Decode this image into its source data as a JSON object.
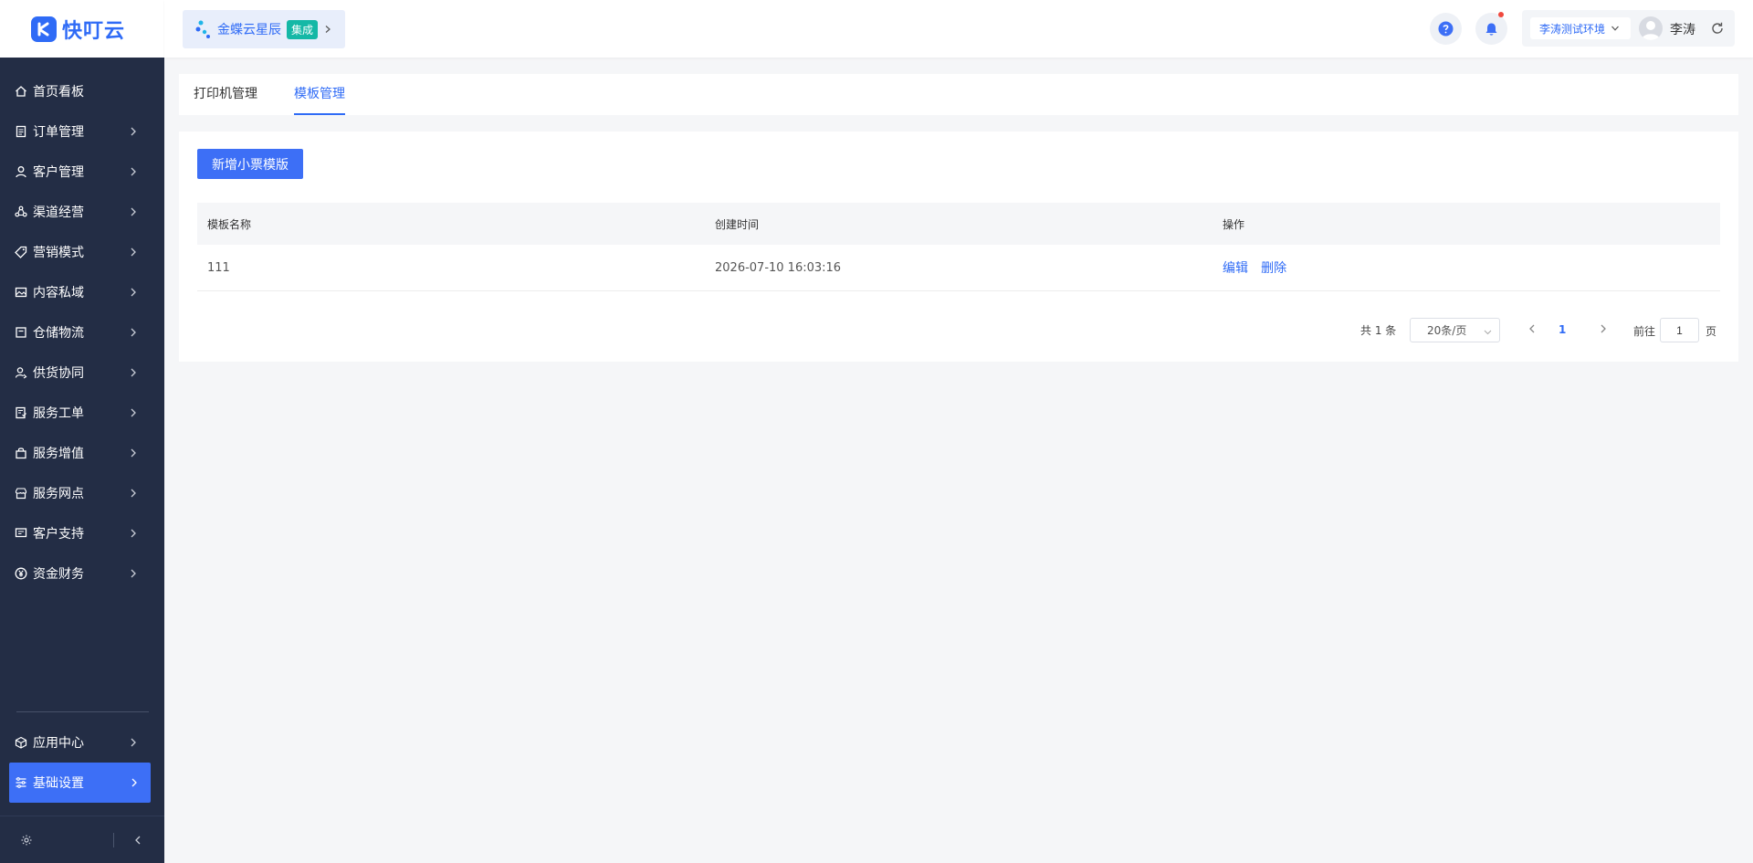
{
  "app": {
    "logo_text": "快叮云"
  },
  "header": {
    "integration": {
      "name": "金蝶云星辰",
      "badge": "集成"
    },
    "environment": "李涛测试环境",
    "username": "李涛"
  },
  "sidebar": {
    "items": [
      {
        "label": "首页看板",
        "icon": "home-icon"
      },
      {
        "label": "订单管理",
        "icon": "clipboard-icon"
      },
      {
        "label": "客户管理",
        "icon": "user-icon"
      },
      {
        "label": "渠道经营",
        "icon": "channel-icon"
      },
      {
        "label": "营销模式",
        "icon": "tag-icon"
      },
      {
        "label": "内容私域",
        "icon": "image-icon"
      },
      {
        "label": "仓储物流",
        "icon": "box-icon"
      },
      {
        "label": "供货协同",
        "icon": "collab-icon"
      },
      {
        "label": "服务工单",
        "icon": "ticket-icon"
      },
      {
        "label": "服务增值",
        "icon": "bag-icon"
      },
      {
        "label": "服务网点",
        "icon": "store-icon"
      },
      {
        "label": "客户支持",
        "icon": "support-icon"
      },
      {
        "label": "资金财务",
        "icon": "yen-icon"
      }
    ],
    "bottom_items": [
      {
        "label": "应用中心",
        "icon": "cube-icon"
      },
      {
        "label": "基础设置",
        "icon": "sliders-icon"
      }
    ]
  },
  "tabs": [
    {
      "label": "打印机管理"
    },
    {
      "label": "模板管理"
    }
  ],
  "main": {
    "add_button": "新增小票模版",
    "table": {
      "columns": [
        "模板名称",
        "创建时间",
        "操作"
      ],
      "rows": [
        {
          "name": "111",
          "created": "2026-07-10 16:03:16",
          "actions": [
            "编辑",
            "删除"
          ]
        }
      ]
    },
    "pagination": {
      "total": "共 1 条",
      "page_size": "20条/页",
      "current_page": "1",
      "goto_label": "前往",
      "goto_value": "1",
      "page_suffix": "页"
    }
  },
  "colors": {
    "primary": "#3d6ff6",
    "sidebar_bg": "#232d45",
    "badge": "#15b8a6",
    "notification_dot": "#f0493e"
  }
}
